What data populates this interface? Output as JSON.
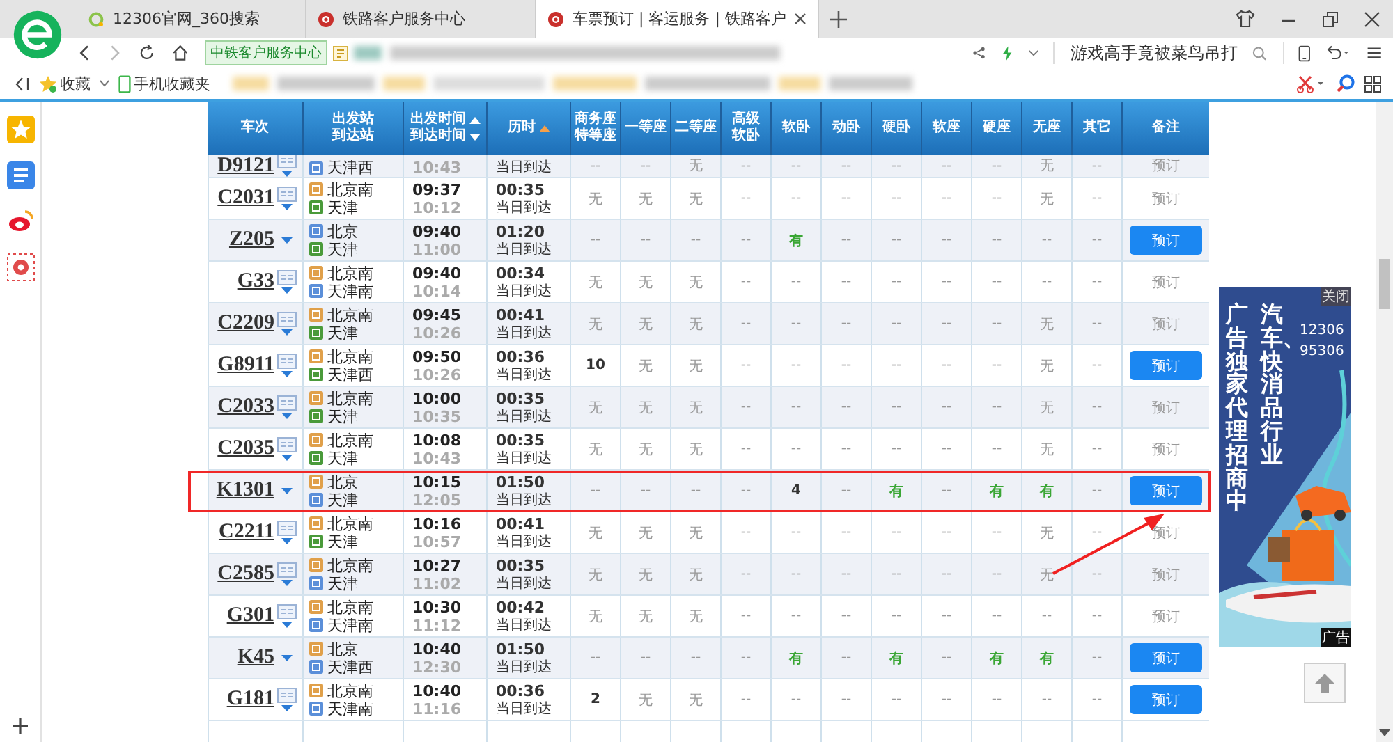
{
  "browser": {
    "tabs": [
      {
        "title": "12306官网_360搜索",
        "kind": "search",
        "selected": false
      },
      {
        "title": "铁路客户服务中心",
        "kind": "rail",
        "selected": false
      },
      {
        "title": "车票预订 | 客运服务 | 铁路客户",
        "kind": "rail",
        "selected": true
      }
    ],
    "site_badge": "中铁客户服务中心",
    "search": {
      "value": "游戏高手竟被菜鸟吊打"
    },
    "bookmarks": [
      {
        "label": "收藏",
        "kind": "star"
      },
      {
        "label": "手机收藏夹",
        "kind": "phone"
      }
    ]
  },
  "table": {
    "columns": [
      {
        "lines": [
          {
            "text": "车次",
            "kind": "plain"
          }
        ]
      },
      {
        "lines": [
          {
            "text": "出发站",
            "kind": "plain"
          },
          {
            "text": "到达站",
            "kind": "plain"
          }
        ]
      },
      {
        "lines": [
          {
            "text": "出发时间",
            "kind": "up"
          },
          {
            "text": "到达时间",
            "kind": "down"
          }
        ],
        "sorted": false
      },
      {
        "lines": [
          {
            "text": "历时",
            "kind": "up"
          }
        ],
        "sorted": true
      },
      {
        "lines": [
          {
            "text": "商务座",
            "kind": "plain"
          },
          {
            "text": "特等座",
            "kind": "plain"
          }
        ]
      },
      {
        "lines": [
          {
            "text": "一等座",
            "kind": "plain"
          }
        ]
      },
      {
        "lines": [
          {
            "text": "二等座",
            "kind": "plain"
          }
        ]
      },
      {
        "lines": [
          {
            "text": "高级",
            "kind": "plain"
          },
          {
            "text": "软卧",
            "kind": "plain"
          }
        ]
      },
      {
        "lines": [
          {
            "text": "软卧",
            "kind": "plain"
          }
        ]
      },
      {
        "lines": [
          {
            "text": "动卧",
            "kind": "plain"
          }
        ]
      },
      {
        "lines": [
          {
            "text": "硬卧",
            "kind": "plain"
          }
        ]
      },
      {
        "lines": [
          {
            "text": "软座",
            "kind": "plain"
          }
        ]
      },
      {
        "lines": [
          {
            "text": "硬座",
            "kind": "plain"
          }
        ]
      },
      {
        "lines": [
          {
            "text": "无座",
            "kind": "plain"
          }
        ]
      },
      {
        "lines": [
          {
            "text": "其它",
            "kind": "plain"
          }
        ]
      },
      {
        "lines": [
          {
            "text": "备注",
            "kind": "plain"
          }
        ]
      }
    ],
    "rows": [
      {
        "kind": "partial",
        "train": "D9121",
        "info": true,
        "to": {
          "name": "天津西",
          "kind": "pass"
        },
        "arrive": "10:43",
        "arrival_note": "当日到达",
        "seats": [
          {
            "text": "--",
            "kind": "plain"
          },
          {
            "text": "--",
            "kind": "plain"
          },
          {
            "text": "无",
            "kind": "plain"
          },
          {
            "text": "--",
            "kind": "plain"
          },
          {
            "text": "--",
            "kind": "plain"
          },
          {
            "text": "--",
            "kind": "plain"
          },
          {
            "text": "--",
            "kind": "plain"
          },
          {
            "text": "--",
            "kind": "plain"
          },
          {
            "text": "--",
            "kind": "plain"
          },
          {
            "text": "无",
            "kind": "plain"
          },
          {
            "text": "--",
            "kind": "plain"
          }
        ],
        "book": {
          "label": "预订",
          "enabled": false
        },
        "highlighted": false
      },
      {
        "kind": "full",
        "train": "C2031",
        "info": true,
        "from": {
          "name": "北京南",
          "kind": "start"
        },
        "to": {
          "name": "天津",
          "kind": "end"
        },
        "depart": "09:37",
        "arrive": "10:12",
        "duration": "00:35",
        "arrival_note": "当日到达",
        "seats": [
          {
            "text": "无",
            "kind": "plain"
          },
          {
            "text": "无",
            "kind": "plain"
          },
          {
            "text": "无",
            "kind": "plain"
          },
          {
            "text": "--",
            "kind": "plain"
          },
          {
            "text": "--",
            "kind": "plain"
          },
          {
            "text": "--",
            "kind": "plain"
          },
          {
            "text": "--",
            "kind": "plain"
          },
          {
            "text": "--",
            "kind": "plain"
          },
          {
            "text": "--",
            "kind": "plain"
          },
          {
            "text": "无",
            "kind": "plain"
          },
          {
            "text": "--",
            "kind": "plain"
          }
        ],
        "book": {
          "label": "预订",
          "enabled": false
        },
        "highlighted": false
      },
      {
        "kind": "full",
        "train": "Z205",
        "info": false,
        "from": {
          "name": "北京",
          "kind": "pass"
        },
        "to": {
          "name": "天津",
          "kind": "end"
        },
        "depart": "09:40",
        "arrive": "11:00",
        "duration": "01:20",
        "arrival_note": "当日到达",
        "seats": [
          {
            "text": "--",
            "kind": "plain"
          },
          {
            "text": "--",
            "kind": "plain"
          },
          {
            "text": "--",
            "kind": "plain"
          },
          {
            "text": "--",
            "kind": "plain"
          },
          {
            "text": "有",
            "kind": "yes"
          },
          {
            "text": "--",
            "kind": "plain"
          },
          {
            "text": "--",
            "kind": "plain"
          },
          {
            "text": "--",
            "kind": "plain"
          },
          {
            "text": "--",
            "kind": "plain"
          },
          {
            "text": "--",
            "kind": "plain"
          },
          {
            "text": "--",
            "kind": "plain"
          }
        ],
        "book": {
          "label": "预订",
          "enabled": true
        },
        "highlighted": false
      },
      {
        "kind": "full",
        "train": "G33",
        "info": true,
        "from": {
          "name": "北京南",
          "kind": "start"
        },
        "to": {
          "name": "天津南",
          "kind": "pass"
        },
        "depart": "09:40",
        "arrive": "10:14",
        "duration": "00:34",
        "arrival_note": "当日到达",
        "seats": [
          {
            "text": "无",
            "kind": "plain"
          },
          {
            "text": "无",
            "kind": "plain"
          },
          {
            "text": "无",
            "kind": "plain"
          },
          {
            "text": "--",
            "kind": "plain"
          },
          {
            "text": "--",
            "kind": "plain"
          },
          {
            "text": "--",
            "kind": "plain"
          },
          {
            "text": "--",
            "kind": "plain"
          },
          {
            "text": "--",
            "kind": "plain"
          },
          {
            "text": "--",
            "kind": "plain"
          },
          {
            "text": "--",
            "kind": "plain"
          },
          {
            "text": "--",
            "kind": "plain"
          }
        ],
        "book": {
          "label": "预订",
          "enabled": false
        },
        "highlighted": false
      },
      {
        "kind": "full",
        "train": "C2209",
        "info": true,
        "from": {
          "name": "北京南",
          "kind": "start"
        },
        "to": {
          "name": "天津",
          "kind": "end"
        },
        "depart": "09:45",
        "arrive": "10:26",
        "duration": "00:41",
        "arrival_note": "当日到达",
        "seats": [
          {
            "text": "无",
            "kind": "plain"
          },
          {
            "text": "无",
            "kind": "plain"
          },
          {
            "text": "无",
            "kind": "plain"
          },
          {
            "text": "--",
            "kind": "plain"
          },
          {
            "text": "--",
            "kind": "plain"
          },
          {
            "text": "--",
            "kind": "plain"
          },
          {
            "text": "--",
            "kind": "plain"
          },
          {
            "text": "--",
            "kind": "plain"
          },
          {
            "text": "--",
            "kind": "plain"
          },
          {
            "text": "无",
            "kind": "plain"
          },
          {
            "text": "--",
            "kind": "plain"
          }
        ],
        "book": {
          "label": "预订",
          "enabled": false
        },
        "highlighted": false
      },
      {
        "kind": "full",
        "train": "G8911",
        "info": true,
        "from": {
          "name": "北京南",
          "kind": "start"
        },
        "to": {
          "name": "天津西",
          "kind": "end"
        },
        "depart": "09:50",
        "arrive": "10:26",
        "duration": "00:36",
        "arrival_note": "当日到达",
        "seats": [
          {
            "text": "10",
            "kind": "count"
          },
          {
            "text": "无",
            "kind": "plain"
          },
          {
            "text": "无",
            "kind": "plain"
          },
          {
            "text": "--",
            "kind": "plain"
          },
          {
            "text": "--",
            "kind": "plain"
          },
          {
            "text": "--",
            "kind": "plain"
          },
          {
            "text": "--",
            "kind": "plain"
          },
          {
            "text": "--",
            "kind": "plain"
          },
          {
            "text": "--",
            "kind": "plain"
          },
          {
            "text": "无",
            "kind": "plain"
          },
          {
            "text": "--",
            "kind": "plain"
          }
        ],
        "book": {
          "label": "预订",
          "enabled": true
        },
        "highlighted": false
      },
      {
        "kind": "full",
        "train": "C2033",
        "info": true,
        "from": {
          "name": "北京南",
          "kind": "start"
        },
        "to": {
          "name": "天津",
          "kind": "end"
        },
        "depart": "10:00",
        "arrive": "10:35",
        "duration": "00:35",
        "arrival_note": "当日到达",
        "seats": [
          {
            "text": "无",
            "kind": "plain"
          },
          {
            "text": "无",
            "kind": "plain"
          },
          {
            "text": "无",
            "kind": "plain"
          },
          {
            "text": "--",
            "kind": "plain"
          },
          {
            "text": "--",
            "kind": "plain"
          },
          {
            "text": "--",
            "kind": "plain"
          },
          {
            "text": "--",
            "kind": "plain"
          },
          {
            "text": "--",
            "kind": "plain"
          },
          {
            "text": "--",
            "kind": "plain"
          },
          {
            "text": "无",
            "kind": "plain"
          },
          {
            "text": "--",
            "kind": "plain"
          }
        ],
        "book": {
          "label": "预订",
          "enabled": false
        },
        "highlighted": false
      },
      {
        "kind": "full",
        "train": "C2035",
        "info": true,
        "from": {
          "name": "北京南",
          "kind": "start"
        },
        "to": {
          "name": "天津",
          "kind": "end"
        },
        "depart": "10:08",
        "arrive": "10:43",
        "duration": "00:35",
        "arrival_note": "当日到达",
        "seats": [
          {
            "text": "无",
            "kind": "plain"
          },
          {
            "text": "无",
            "kind": "plain"
          },
          {
            "text": "无",
            "kind": "plain"
          },
          {
            "text": "--",
            "kind": "plain"
          },
          {
            "text": "--",
            "kind": "plain"
          },
          {
            "text": "--",
            "kind": "plain"
          },
          {
            "text": "--",
            "kind": "plain"
          },
          {
            "text": "--",
            "kind": "plain"
          },
          {
            "text": "--",
            "kind": "plain"
          },
          {
            "text": "无",
            "kind": "plain"
          },
          {
            "text": "--",
            "kind": "plain"
          }
        ],
        "book": {
          "label": "预订",
          "enabled": false
        },
        "highlighted": false
      },
      {
        "kind": "full",
        "train": "K1301",
        "info": false,
        "from": {
          "name": "北京",
          "kind": "start"
        },
        "to": {
          "name": "天津",
          "kind": "pass"
        },
        "depart": "10:15",
        "arrive": "12:05",
        "duration": "01:50",
        "arrival_note": "当日到达",
        "seats": [
          {
            "text": "--",
            "kind": "plain"
          },
          {
            "text": "--",
            "kind": "plain"
          },
          {
            "text": "--",
            "kind": "plain"
          },
          {
            "text": "--",
            "kind": "plain"
          },
          {
            "text": "4",
            "kind": "count"
          },
          {
            "text": "--",
            "kind": "plain"
          },
          {
            "text": "有",
            "kind": "yes"
          },
          {
            "text": "--",
            "kind": "plain"
          },
          {
            "text": "有",
            "kind": "yes"
          },
          {
            "text": "有",
            "kind": "yes"
          },
          {
            "text": "--",
            "kind": "plain"
          }
        ],
        "book": {
          "label": "预订",
          "enabled": true
        },
        "highlighted": true
      },
      {
        "kind": "full",
        "train": "C2211",
        "info": true,
        "from": {
          "name": "北京南",
          "kind": "start"
        },
        "to": {
          "name": "天津",
          "kind": "end"
        },
        "depart": "10:16",
        "arrive": "10:57",
        "duration": "00:41",
        "arrival_note": "当日到达",
        "seats": [
          {
            "text": "无",
            "kind": "plain"
          },
          {
            "text": "无",
            "kind": "plain"
          },
          {
            "text": "无",
            "kind": "plain"
          },
          {
            "text": "--",
            "kind": "plain"
          },
          {
            "text": "--",
            "kind": "plain"
          },
          {
            "text": "--",
            "kind": "plain"
          },
          {
            "text": "--",
            "kind": "plain"
          },
          {
            "text": "--",
            "kind": "plain"
          },
          {
            "text": "--",
            "kind": "plain"
          },
          {
            "text": "无",
            "kind": "plain"
          },
          {
            "text": "--",
            "kind": "plain"
          }
        ],
        "book": {
          "label": "预订",
          "enabled": false
        },
        "highlighted": false
      },
      {
        "kind": "full",
        "train": "C2585",
        "info": true,
        "from": {
          "name": "北京南",
          "kind": "start"
        },
        "to": {
          "name": "天津",
          "kind": "pass"
        },
        "depart": "10:27",
        "arrive": "11:02",
        "duration": "00:35",
        "arrival_note": "当日到达",
        "seats": [
          {
            "text": "无",
            "kind": "plain"
          },
          {
            "text": "无",
            "kind": "plain"
          },
          {
            "text": "无",
            "kind": "plain"
          },
          {
            "text": "--",
            "kind": "plain"
          },
          {
            "text": "--",
            "kind": "plain"
          },
          {
            "text": "--",
            "kind": "plain"
          },
          {
            "text": "--",
            "kind": "plain"
          },
          {
            "text": "--",
            "kind": "plain"
          },
          {
            "text": "--",
            "kind": "plain"
          },
          {
            "text": "无",
            "kind": "plain"
          },
          {
            "text": "--",
            "kind": "plain"
          }
        ],
        "book": {
          "label": "预订",
          "enabled": false
        },
        "highlighted": false
      },
      {
        "kind": "full",
        "train": "G301",
        "info": true,
        "from": {
          "name": "北京南",
          "kind": "start"
        },
        "to": {
          "name": "天津南",
          "kind": "pass"
        },
        "depart": "10:30",
        "arrive": "11:12",
        "duration": "00:42",
        "arrival_note": "当日到达",
        "seats": [
          {
            "text": "无",
            "kind": "plain"
          },
          {
            "text": "无",
            "kind": "plain"
          },
          {
            "text": "无",
            "kind": "plain"
          },
          {
            "text": "--",
            "kind": "plain"
          },
          {
            "text": "--",
            "kind": "plain"
          },
          {
            "text": "--",
            "kind": "plain"
          },
          {
            "text": "--",
            "kind": "plain"
          },
          {
            "text": "--",
            "kind": "plain"
          },
          {
            "text": "--",
            "kind": "plain"
          },
          {
            "text": "--",
            "kind": "plain"
          },
          {
            "text": "--",
            "kind": "plain"
          }
        ],
        "book": {
          "label": "预订",
          "enabled": false
        },
        "highlighted": false
      },
      {
        "kind": "full",
        "train": "K45",
        "info": false,
        "from": {
          "name": "北京",
          "kind": "start"
        },
        "to": {
          "name": "天津西",
          "kind": "pass"
        },
        "depart": "10:40",
        "arrive": "12:30",
        "duration": "01:50",
        "arrival_note": "当日到达",
        "seats": [
          {
            "text": "--",
            "kind": "plain"
          },
          {
            "text": "--",
            "kind": "plain"
          },
          {
            "text": "--",
            "kind": "plain"
          },
          {
            "text": "--",
            "kind": "plain"
          },
          {
            "text": "有",
            "kind": "yes"
          },
          {
            "text": "--",
            "kind": "plain"
          },
          {
            "text": "有",
            "kind": "yes"
          },
          {
            "text": "--",
            "kind": "plain"
          },
          {
            "text": "有",
            "kind": "yes"
          },
          {
            "text": "有",
            "kind": "yes"
          },
          {
            "text": "--",
            "kind": "plain"
          }
        ],
        "book": {
          "label": "预订",
          "enabled": true
        },
        "highlighted": false
      },
      {
        "kind": "full",
        "train": "G181",
        "info": true,
        "from": {
          "name": "北京南",
          "kind": "start"
        },
        "to": {
          "name": "天津南",
          "kind": "pass"
        },
        "depart": "10:40",
        "arrive": "11:16",
        "duration": "00:36",
        "arrival_note": "当日到达",
        "seats": [
          {
            "text": "2",
            "kind": "count"
          },
          {
            "text": "无",
            "kind": "plain"
          },
          {
            "text": "无",
            "kind": "plain"
          },
          {
            "text": "--",
            "kind": "plain"
          },
          {
            "text": "--",
            "kind": "plain"
          },
          {
            "text": "--",
            "kind": "plain"
          },
          {
            "text": "--",
            "kind": "plain"
          },
          {
            "text": "--",
            "kind": "plain"
          },
          {
            "text": "--",
            "kind": "plain"
          },
          {
            "text": "--",
            "kind": "plain"
          },
          {
            "text": "--",
            "kind": "plain"
          }
        ],
        "book": {
          "label": "预订",
          "enabled": true
        },
        "highlighted": false
      }
    ]
  },
  "ad": {
    "close": "关闭",
    "headline": "广告独家代理招商中",
    "subline": "汽车、快消品行业",
    "numbers": [
      "12306",
      "95306"
    ],
    "tag": "广告"
  }
}
